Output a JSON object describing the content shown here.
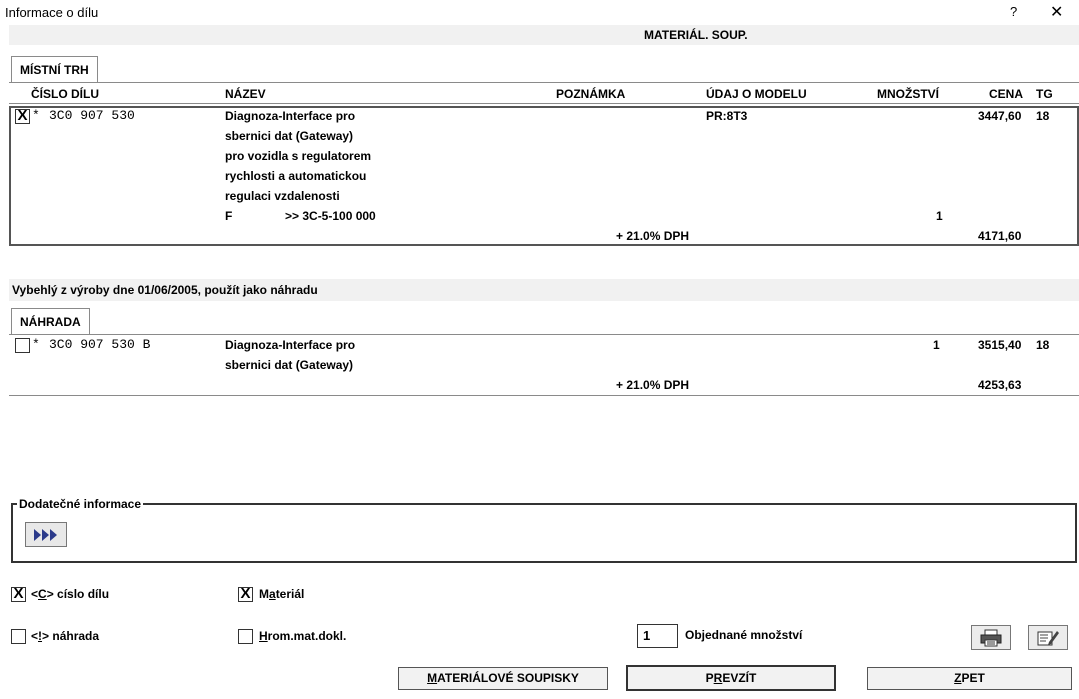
{
  "window": {
    "title": "Informace o dílu",
    "help": "?",
    "close": "✕"
  },
  "header": {
    "label": "MATERIÁL. SOUP."
  },
  "local_market": {
    "tab_label": "MÍSTNÍ TRH",
    "columns": {
      "part_no": "ČÍSLO DÍLU",
      "name": "NÁZEV",
      "note": "POZNÁMKA",
      "model": "ÚDAJ O MODELU",
      "qty": "MNOŽSTVÍ",
      "price": "CENA",
      "tg": "TG"
    },
    "row": {
      "checked": "X",
      "star": "*",
      "part_no": "3C0 907 530",
      "name_lines": [
        "Diagnoza-Interface pro",
        "sbernici dat (Gateway)",
        "pro vozidla s regulatorem",
        "rychlosti a automatickou",
        "regulaci vzdalenosti"
      ],
      "f_label": "F",
      "f_value": ">> 3C-5-100 000",
      "model": "PR:8T3",
      "qty": "1",
      "price": "3447,60",
      "tg": "18",
      "vat_label": "+ 21.0% DPH",
      "price_vat": "4171,60"
    }
  },
  "notice": "Vybehlý z výroby dne 01/06/2005, použít jako náhradu",
  "replacement": {
    "tab_label": "NÁHRADA",
    "row": {
      "star": "*",
      "part_no": "3C0 907 530 B",
      "name_lines": [
        "Diagnoza-Interface pro",
        "sbernici dat (Gateway)"
      ],
      "qty": "1",
      "price": "3515,40",
      "tg": "18",
      "vat_label": "+ 21.0% DPH",
      "price_vat": "4253,63"
    }
  },
  "additional": {
    "legend": "Dodatečné informace"
  },
  "options": {
    "part_no": {
      "pre": "<",
      "key": "C",
      "post": "> císlo dílu",
      "checked": "X"
    },
    "material": {
      "pre": "M",
      "key": "a",
      "post": "teriál",
      "checked": "X"
    },
    "replacement": {
      "pre": "<",
      "key": "!",
      "post": "> náhrada"
    },
    "hrom": {
      "pre": "",
      "key": "H",
      "post": "rom.mat.dokl."
    }
  },
  "ordered_qty": {
    "value": "1",
    "label": "Objednané množství"
  },
  "buttons": {
    "material_lists": {
      "key": "M",
      "rest": "ATERIÁLOVÉ SOUPISKY"
    },
    "take_over": {
      "pre": "P",
      "key": "R",
      "rest": "EVZÍT"
    },
    "back": {
      "key": "Z",
      "rest": "PET"
    }
  }
}
